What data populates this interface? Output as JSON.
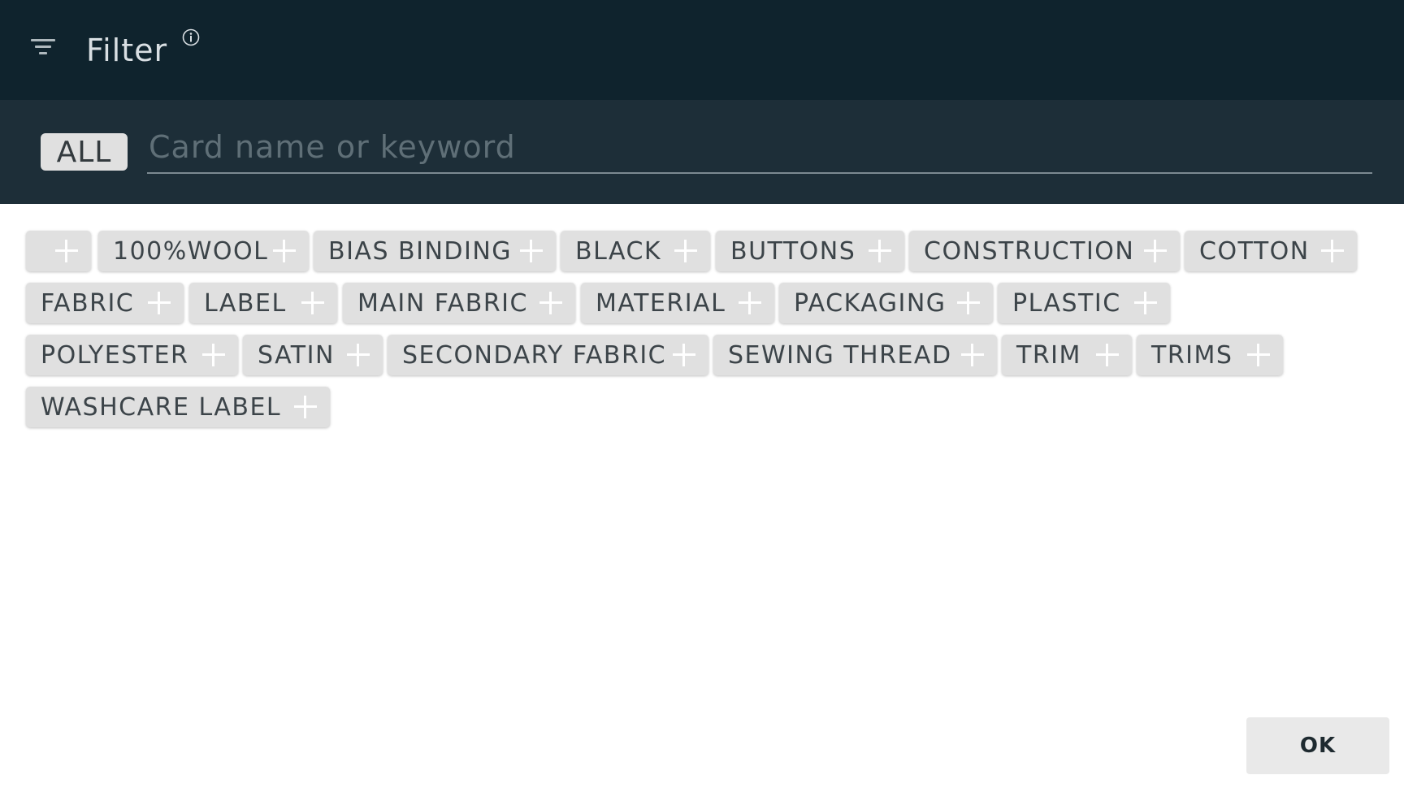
{
  "header": {
    "title": "Filter",
    "icon": "filter-list-icon",
    "info_icon": "info-icon"
  },
  "search": {
    "scope_label": "ALL",
    "placeholder": "Card name or keyword",
    "value": ""
  },
  "tags": [
    "",
    "100%WOOL",
    "BIAS BINDING",
    "BLACK",
    "BUTTONS",
    "CONSTRUCTION",
    "COTTON",
    "FABRIC",
    "LABEL",
    "MAIN FABRIC",
    "MATERIAL",
    "PACKAGING",
    "PLASTIC",
    "POLYESTER",
    "SATIN",
    "SECONDARY FABRIC",
    "SEWING THREAD",
    "TRIM",
    "TRIMS",
    "WASHCARE LABEL"
  ],
  "footer": {
    "ok_label": "OK"
  },
  "colors": {
    "header_bg": "#0f232d",
    "search_bg": "#1d2e38",
    "chip_bg": "#e0e0e0",
    "chip_text": "#3c4449"
  }
}
